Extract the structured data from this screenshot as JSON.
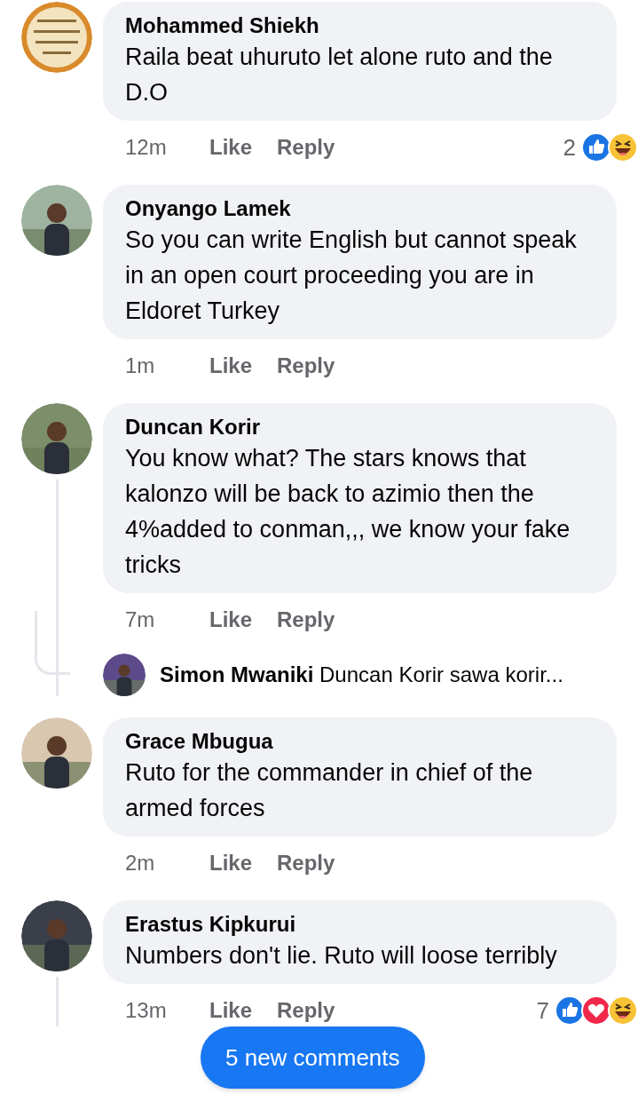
{
  "comments": [
    {
      "author": "Mohammed Shiekh",
      "text": "Raila beat uhuruto let alone ruto and the D.O",
      "time": "12m",
      "like": "Like",
      "reply": "Reply",
      "reaction_count": "2",
      "reactions": [
        {
          "kind": "like"
        },
        {
          "kind": "haha"
        }
      ],
      "thread": false
    },
    {
      "author": "Onyango Lamek",
      "text": "So you can write English but cannot speak in an open court proceeding you are in Eldoret Turkey",
      "time": "1m",
      "like": "Like",
      "reply": "Reply",
      "thread": false
    },
    {
      "author": "Duncan Korir",
      "text": "You know what? The stars knows that kalonzo will be back to azimio then the 4%added to conman,,, we know your fake tricks",
      "time": "7m",
      "like": "Like",
      "reply": "Reply",
      "thread": true,
      "replies": [
        {
          "author": "Simon Mwaniki",
          "text": "Duncan Korir sawa korir..."
        }
      ]
    },
    {
      "author": "Grace Mbugua",
      "text": "Ruto for the commander in chief of the armed forces",
      "time": "2m",
      "like": "Like",
      "reply": "Reply",
      "thread": false
    },
    {
      "author": "Erastus Kipkurui",
      "text": "Numbers don't lie. Ruto will loose terribly",
      "time": "13m",
      "like": "Like",
      "reply": "Reply",
      "reaction_count": "7",
      "reactions": [
        {
          "kind": "like"
        },
        {
          "kind": "love"
        },
        {
          "kind": "haha"
        }
      ],
      "thread": true
    }
  ],
  "new_comments_button": "5 new comments"
}
